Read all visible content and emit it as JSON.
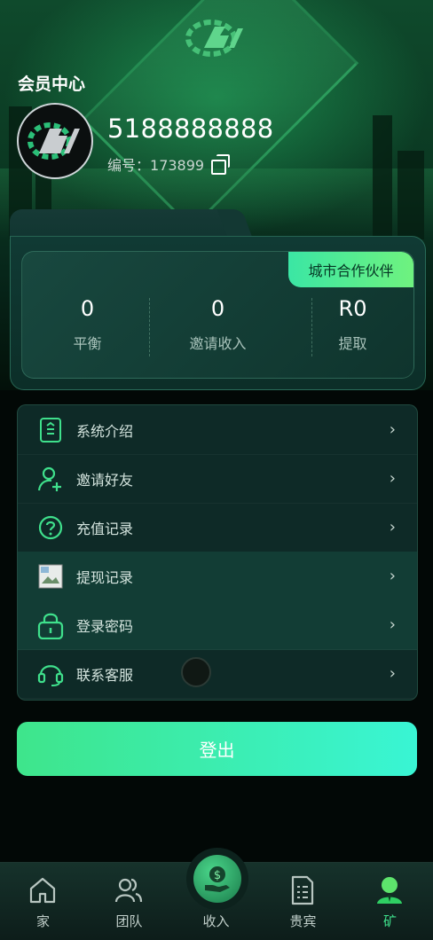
{
  "header": {
    "title": "会员中心",
    "username": "5188888888",
    "id_label": "编号：",
    "id_value": "173899"
  },
  "stats": {
    "badge": "城市合作伙伴",
    "items": [
      {
        "value": "0",
        "label": "平衡"
      },
      {
        "value": "0",
        "label": "邀请收入"
      },
      {
        "value": "R0",
        "label": "提取"
      }
    ]
  },
  "menu": {
    "items": [
      {
        "label": "系统介绍",
        "icon": "document-icon"
      },
      {
        "label": "邀请好友",
        "icon": "add-user-icon"
      },
      {
        "label": "充值记录",
        "icon": "question-icon"
      },
      {
        "label": "提现记录",
        "icon": "broken-image-icon"
      },
      {
        "label": "登录密码",
        "icon": "lock-icon"
      },
      {
        "label": "联系客服",
        "icon": "headset-icon"
      }
    ],
    "chevron": "›"
  },
  "logout_label": "登出",
  "nav": {
    "items": [
      {
        "label": "家",
        "icon": "home-icon"
      },
      {
        "label": "团队",
        "icon": "team-icon"
      },
      {
        "label": "收入",
        "icon": "income-icon"
      },
      {
        "label": "贵宾",
        "icon": "vip-icon"
      },
      {
        "label": "矿",
        "icon": "mine-icon"
      }
    ],
    "active_index": 4
  },
  "colors": {
    "accent": "#3fe08c",
    "badge_start": "#3be6a4",
    "badge_end": "#6ff27f",
    "button_start": "#3ee58b",
    "button_end": "#39f5d4"
  }
}
